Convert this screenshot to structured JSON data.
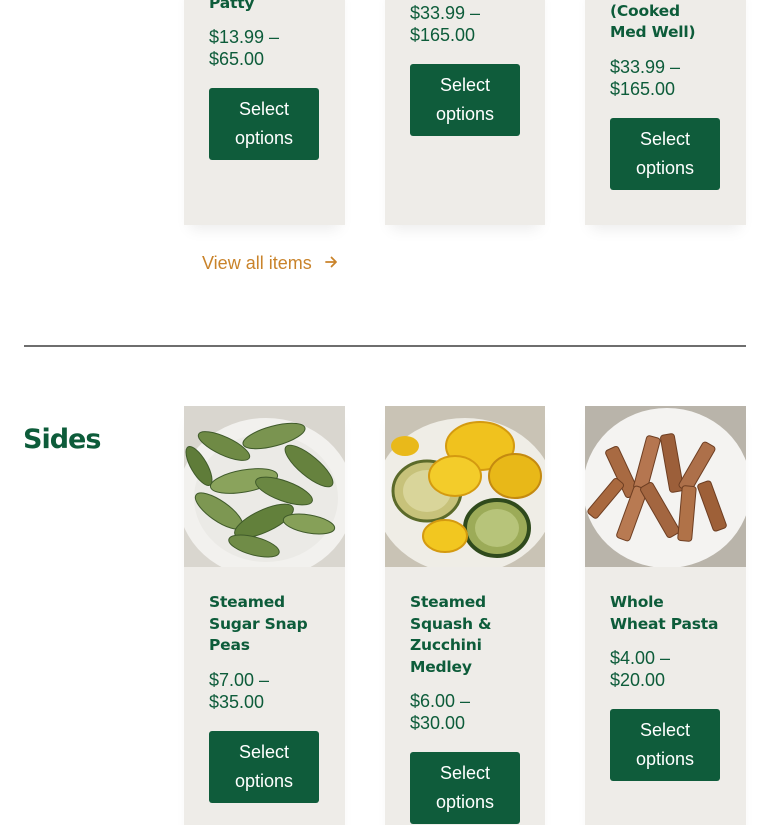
{
  "top_products": [
    {
      "name": "Patty",
      "price": "$13.99 – $65.00",
      "button": "Select options"
    },
    {
      "name": "",
      "price": "$33.99 – $165.00",
      "button": "Select options"
    },
    {
      "name": "Steak (Cooked Med Well)",
      "price": "$33.99 – $165.00",
      "button": "Select options"
    }
  ],
  "view_all": {
    "label": "View all items",
    "icon": "arrow-right-icon"
  },
  "sides": {
    "title": "Sides",
    "products": [
      {
        "name": "Steamed Sugar Snap Peas",
        "price": "$7.00 – $35.00",
        "button": "Select options",
        "image": "sugar-snap-peas"
      },
      {
        "name": "Steamed Squash & Zucchini Medley",
        "price": "$6.00 – $30.00",
        "button": "Select options",
        "image": "squash-zucchini"
      },
      {
        "name": "Whole Wheat Pasta",
        "price": "$4.00 – $20.00",
        "button": "Select options",
        "image": "whole-wheat-pasta"
      }
    ]
  },
  "colors": {
    "brand_green": "#0f5c3b",
    "card_bg": "#eeece8",
    "link_orange": "#c9832a",
    "divider": "#6e6e6e"
  }
}
